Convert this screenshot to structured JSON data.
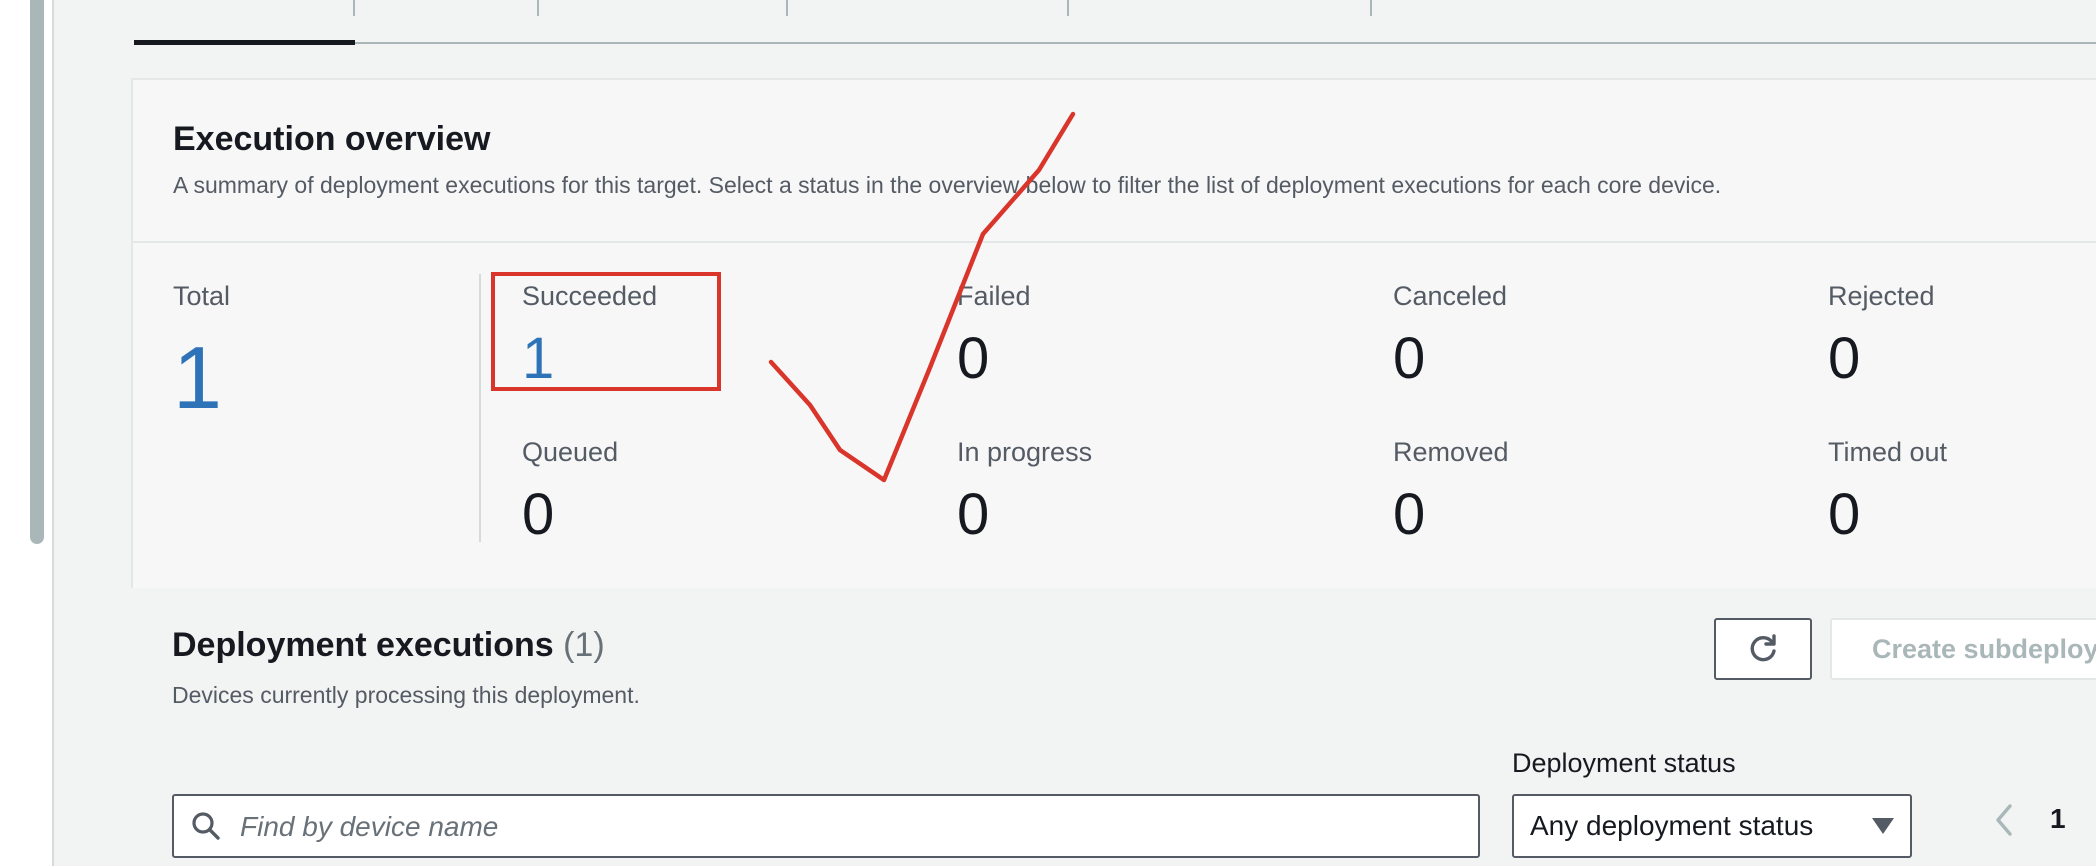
{
  "overview": {
    "title": "Execution overview",
    "description": "A summary of deployment executions for this target. Select a status in the overview below to filter the list of deployment executions for each core device.",
    "total": {
      "label": "Total",
      "value": "1"
    },
    "stats": {
      "succeeded": {
        "label": "Succeeded",
        "value": "1"
      },
      "failed": {
        "label": "Failed",
        "value": "0"
      },
      "canceled": {
        "label": "Canceled",
        "value": "0"
      },
      "rejected": {
        "label": "Rejected",
        "value": "0"
      },
      "queued": {
        "label": "Queued",
        "value": "0"
      },
      "in_progress": {
        "label": "In progress",
        "value": "0"
      },
      "removed": {
        "label": "Removed",
        "value": "0"
      },
      "timed_out": {
        "label": "Timed out",
        "value": "0"
      }
    }
  },
  "executions": {
    "title": "Deployment executions",
    "count": "(1)",
    "description": "Devices currently processing this deployment.",
    "create_button_label": "Create subdeploy",
    "filter_label": "Deployment status",
    "search_placeholder": "Find by device name",
    "status_select_value": "Any deployment status",
    "current_page": "1"
  },
  "colors": {
    "link_blue": "#2e73b8",
    "annotation_red": "#d9352b",
    "text_primary": "#16191f",
    "text_secondary": "#545b64"
  },
  "icons": {
    "refresh": "refresh-icon",
    "search": "search-icon",
    "caret": "caret-down-icon",
    "prev": "chevron-left-icon"
  }
}
